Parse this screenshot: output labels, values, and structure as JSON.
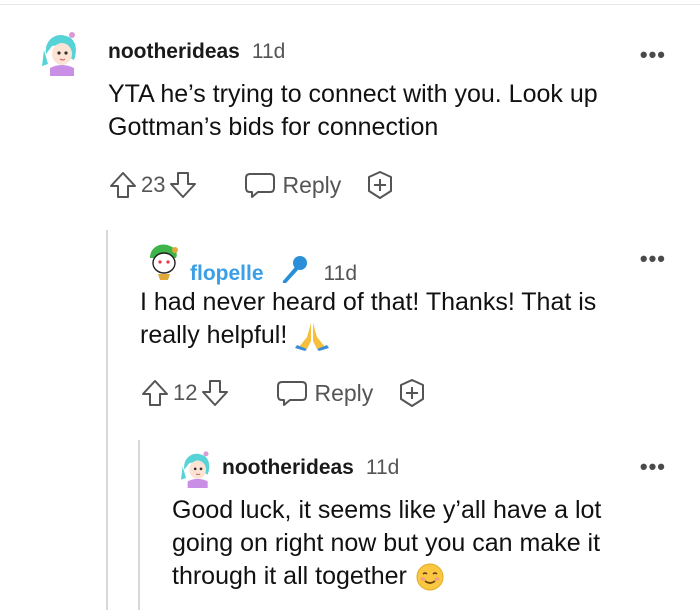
{
  "comments": [
    {
      "username": "nootherideas",
      "time": "11d",
      "more": "•••",
      "body": "YTA he’s trying to connect with you. Look up Gottman’s bids for connection",
      "votes": "23",
      "reply_label": "Reply",
      "icons": [
        "avatar",
        "upvote-icon",
        "downvote-icon",
        "reply-icon",
        "award-icon"
      ]
    },
    {
      "username": "flopelle",
      "time": "11d",
      "more": "•••",
      "body_line1": "I had never heard of that! Thanks! That is",
      "body_line2": "really helpful!",
      "votes": "12",
      "reply_label": "Reply",
      "icons": [
        "avatar",
        "microphone-flair-icon",
        "praying-hands-emoji",
        "upvote-icon",
        "downvote-icon",
        "reply-icon",
        "award-icon"
      ]
    },
    {
      "username": "nootherideas",
      "time": "11d",
      "more": "•••",
      "body_line1": "Good luck, it seems like y’all have a lot",
      "body_line2": "going on right now but you can make it",
      "body_line3": "through it all together",
      "icons": [
        "avatar",
        "smiling-face-emoji"
      ]
    }
  ],
  "colors": {
    "username_highlight": "#3a9fe5",
    "meta_gray": "#555555"
  }
}
